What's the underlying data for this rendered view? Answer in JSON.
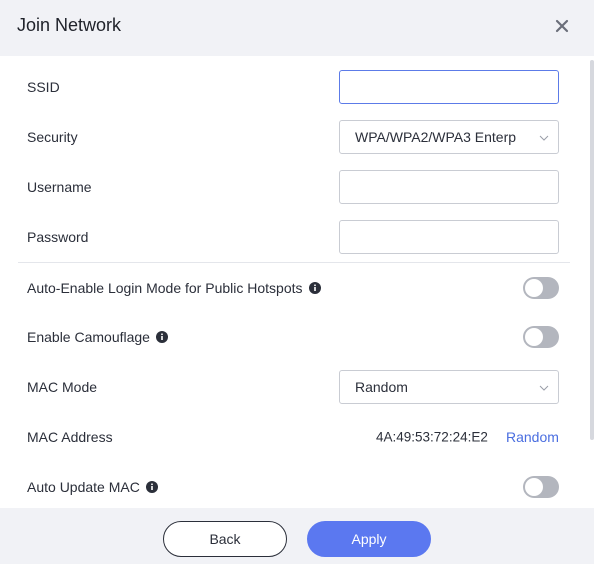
{
  "dialog": {
    "title": "Join Network",
    "close_icon": "close-icon"
  },
  "form": {
    "ssid": {
      "label": "SSID",
      "value": "",
      "placeholder": ""
    },
    "security": {
      "label": "Security",
      "value": "WPA/WPA2/WPA3 Enterp"
    },
    "username": {
      "label": "Username",
      "value": "",
      "placeholder": ""
    },
    "password": {
      "label": "Password",
      "value": "",
      "placeholder": ""
    },
    "auto_login": {
      "label": "Auto-Enable Login Mode for Public Hotspots",
      "enabled": false
    },
    "camouflage": {
      "label": "Enable Camouflage",
      "enabled": false
    },
    "mac_mode": {
      "label": "MAC Mode",
      "value": "Random"
    },
    "mac_address": {
      "label": "MAC Address",
      "value": "4A:49:53:72:24:E2",
      "action": "Random"
    },
    "auto_update_mac": {
      "label": "Auto Update MAC",
      "enabled": false
    }
  },
  "footer": {
    "back_label": "Back",
    "apply_label": "Apply"
  },
  "colors": {
    "accent": "#5b78f0",
    "link": "#4a6ee0",
    "toggle_off": "#b3b6be",
    "header_bg": "#f1f2f6"
  }
}
